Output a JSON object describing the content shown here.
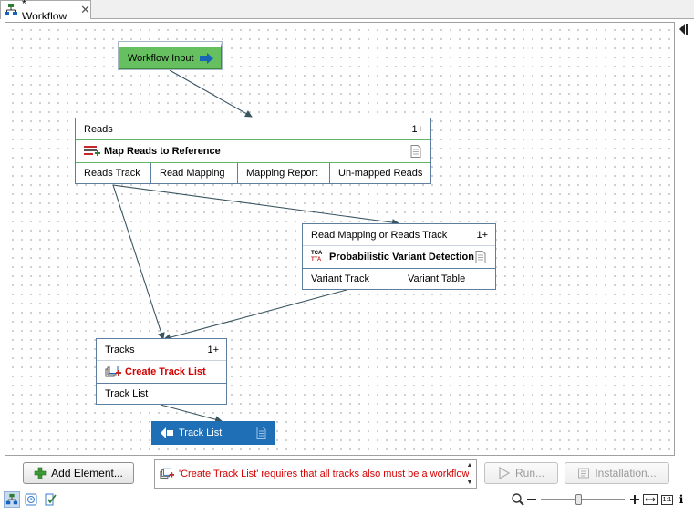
{
  "tab": {
    "title": "* Workflow",
    "close": "✕"
  },
  "workflow_input": {
    "label": "Workflow Input"
  },
  "map_reads_node": {
    "input_label": "Reads",
    "input_count": "1+",
    "title": "Map Reads to Reference",
    "outputs": [
      "Reads Track",
      "Read Mapping",
      "Mapping Report",
      "Un-mapped Reads"
    ]
  },
  "variant_node": {
    "input_label": "Read Mapping or Reads Track",
    "input_count": "1+",
    "icon_text_top": "TCA",
    "icon_text_bottom": "TTA",
    "title": "Probabilistic Variant Detection",
    "outputs": [
      "Variant Track",
      "Variant Table"
    ]
  },
  "track_list_node": {
    "input_label": "Tracks",
    "input_count": "1+",
    "title": "Create Track List",
    "title_color": "#d40000",
    "outputs": [
      "Track List"
    ]
  },
  "workflow_output": {
    "label": "Track List"
  },
  "footer": {
    "add_element": "Add Element...",
    "message": "'Create Track List' requires that all tracks also must be a workflow",
    "run": "Run...",
    "installation": "Installation..."
  },
  "zoom": {
    "level": 0.45,
    "fit_label": "1:1"
  },
  "colors": {
    "input_green": "#66c060",
    "output_blue": "#1f6fb7",
    "edge": "#3a5560",
    "error_red": "#d40000"
  },
  "icons": [
    "workflow-icon",
    "close-icon",
    "collapse-panel-icon",
    "input-arrow-icon",
    "map-reads-icon",
    "variant-detection-icon",
    "track-list-icon",
    "document-icon",
    "output-arrow-icon",
    "add-icon",
    "run-icon",
    "installation-icon",
    "zoom-icon",
    "zoom-out-icon",
    "zoom-in-icon",
    "fit-width-icon",
    "actual-size-icon",
    "info-icon",
    "editor-view-icon",
    "history-view-icon",
    "validation-view-icon"
  ]
}
